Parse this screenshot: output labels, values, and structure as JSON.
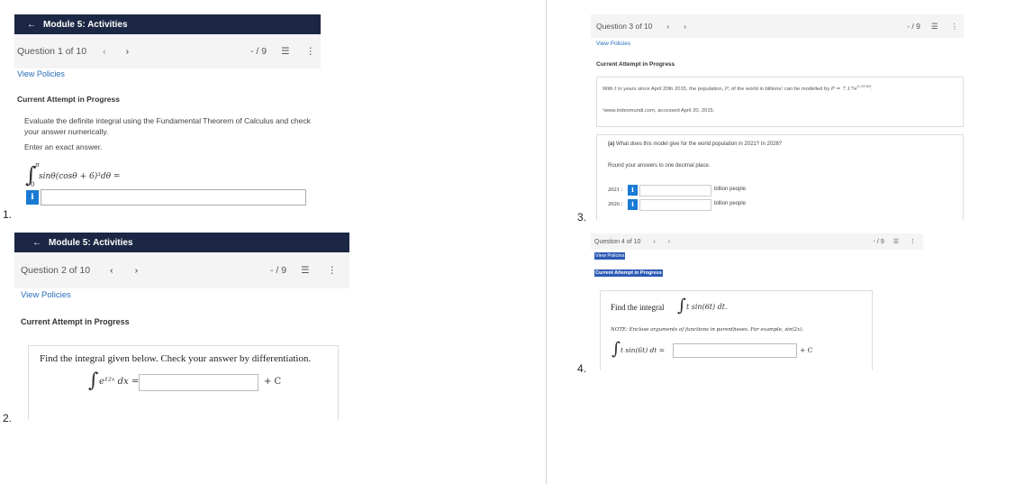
{
  "labels": [
    "1.",
    "2.",
    "3.",
    "4."
  ],
  "panel1": {
    "module_title": "Module 5: Activities",
    "question": "Question 1 of 10",
    "prev": "‹",
    "next": "›",
    "score": "- / 9",
    "view_policies": "View Policies",
    "attempt": "Current Attempt in Progress",
    "instructions": "Evaluate the definite integral using the Fundamental Theorem of Calculus and check your answer numerically.",
    "exact": "Enter an exact answer.",
    "integral_upper": "π",
    "integral_lower": "0",
    "integrand": "sinθ(cosθ + 6)³dθ =",
    "info": "i"
  },
  "panel2": {
    "module_title": "Module 5: Activities",
    "question": "Question 2 of 10",
    "prev": "‹",
    "next": "›",
    "score": "- / 9",
    "view_policies": "View Policies",
    "attempt": "Current Attempt in Progress",
    "prompt": "Find the integral given below. Check your answer by differentiation.",
    "integrand": "e¹²ˣ dx =",
    "plus_c": "+ C"
  },
  "panel3": {
    "question": "Question 3 of 10",
    "prev": "‹",
    "next": "›",
    "score": "- / 9",
    "view_policies": "View Policies",
    "attempt": "Current Attempt in Progress",
    "intro_start": "With ",
    "intro_var": "t",
    "intro_mid": " in years since April 20th 2015, the population, ",
    "intro_p": "P",
    "intro_end": ", of the world in billions¹ can be modelled by ",
    "formula": "P = 7.17e",
    "formula_exp": "0.0106t",
    "footnote": "¹www.indexmundi.com, accessed April 20, 2015.",
    "part_a_label": "(a)",
    "part_a": " What does this model give for the world population in 2021? In 2026?",
    "round": "Round your answers to one decimal place.",
    "rows": [
      {
        "year": "2021 :",
        "unit": "billion people"
      },
      {
        "year": "2026 :",
        "unit": "billion people"
      }
    ],
    "info": "i"
  },
  "panel4": {
    "question": "Question 4 of 10",
    "prev": "‹",
    "next": "›",
    "score": "- / 9",
    "view_policies": "View Policies",
    "attempt": "Current Attempt in Progress",
    "prompt_text": "Find the integral",
    "prompt_math": "t sin(6t) dt.",
    "note": "NOTE: Enclose arguments of functions in parentheses. For example, sin(2x).",
    "integrand": "t sin(6t) dt =",
    "plus_c": "+ C"
  }
}
